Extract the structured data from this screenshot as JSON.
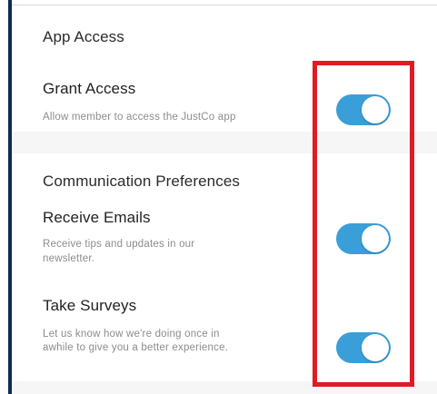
{
  "app_access": {
    "section_title": "App Access",
    "grant_access": {
      "title": "Grant Access",
      "description": "Allow member to access the JustCo app",
      "enabled": true
    }
  },
  "communication_preferences": {
    "section_title": "Communication Preferences",
    "receive_emails": {
      "title": "Receive Emails",
      "description_line1": "Receive tips and updates in our",
      "description_line2": "newsletter.",
      "enabled": true
    },
    "take_surveys": {
      "title": "Take Surveys",
      "description_line1": "Let us know how we're doing once in",
      "description_line2": "awhile to give you a better experience.",
      "enabled": true
    }
  },
  "colors": {
    "toggle_on": "#3a9fd8",
    "highlight": "#e01b24",
    "left_accent": "#0f2c4f"
  }
}
